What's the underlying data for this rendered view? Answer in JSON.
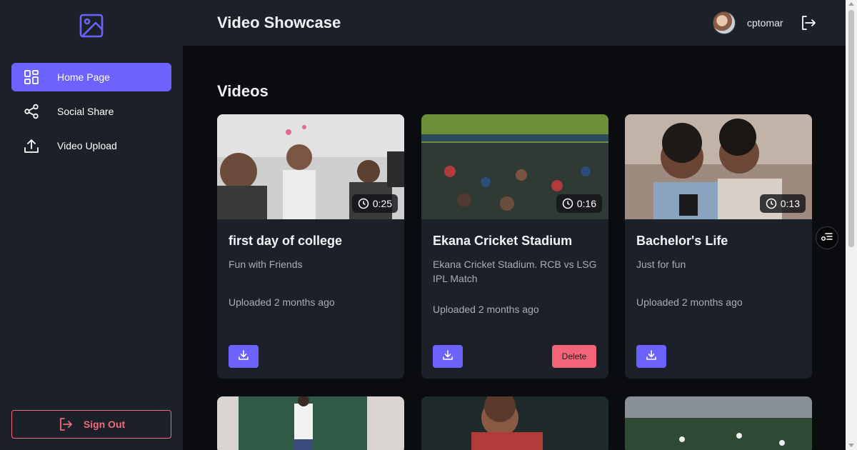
{
  "app": {
    "title": "Video Showcase"
  },
  "user": {
    "name": "cptomar"
  },
  "sidebar": {
    "items": [
      {
        "label": "Home Page",
        "icon": "dashboard-icon",
        "active": true
      },
      {
        "label": "Social Share",
        "icon": "share-icon",
        "active": false
      },
      {
        "label": "Video Upload",
        "icon": "upload-icon",
        "active": false
      }
    ],
    "sign_out_label": "Sign Out"
  },
  "main": {
    "section_title": "Videos",
    "videos": [
      {
        "title": "first day of college",
        "description": "Fun with Friends",
        "duration": "0:25",
        "uploaded": "Uploaded 2 months ago",
        "has_delete": false
      },
      {
        "title": "Ekana Cricket Stadium",
        "description": "Ekana Cricket Stadium. RCB vs LSG IPL Match",
        "duration": "0:16",
        "uploaded": "Uploaded 2 months ago",
        "has_delete": true,
        "delete_label": "Delete"
      },
      {
        "title": "Bachelor's Life",
        "description": "Just for fun",
        "duration": "0:13",
        "uploaded": "Uploaded 2 months ago",
        "has_delete": false
      }
    ]
  },
  "colors": {
    "accent": "#6c63ff",
    "danger": "#f26479",
    "sidebar_bg": "#1c2029",
    "card_bg": "#1c2029",
    "page_bg": "#0b0c0f"
  }
}
